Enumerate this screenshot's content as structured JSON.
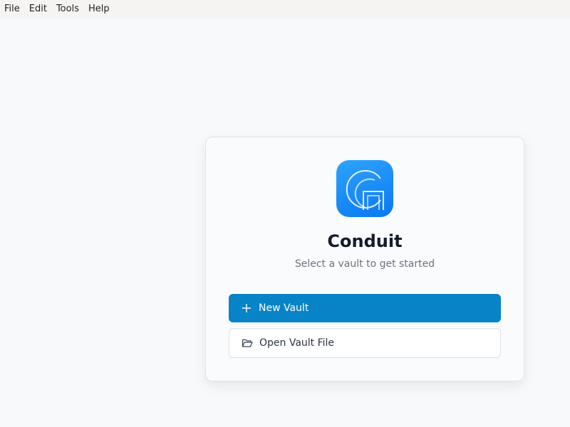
{
  "menubar": {
    "items": [
      "File",
      "Edit",
      "Tools",
      "Help"
    ]
  },
  "welcome": {
    "logo_icon": "conduit-logo-icon",
    "title": "Conduit",
    "subtitle": "Select a vault to get started",
    "new_vault_label": "New Vault",
    "new_vault_icon": "plus-icon",
    "open_vault_label": "Open Vault File",
    "open_vault_icon": "folder-open-icon"
  },
  "colors": {
    "primary_button": "#0783c8",
    "logo_gradient_start": "#2ea3ff",
    "logo_gradient_end": "#0a78f0",
    "background": "#f8f9fb"
  }
}
